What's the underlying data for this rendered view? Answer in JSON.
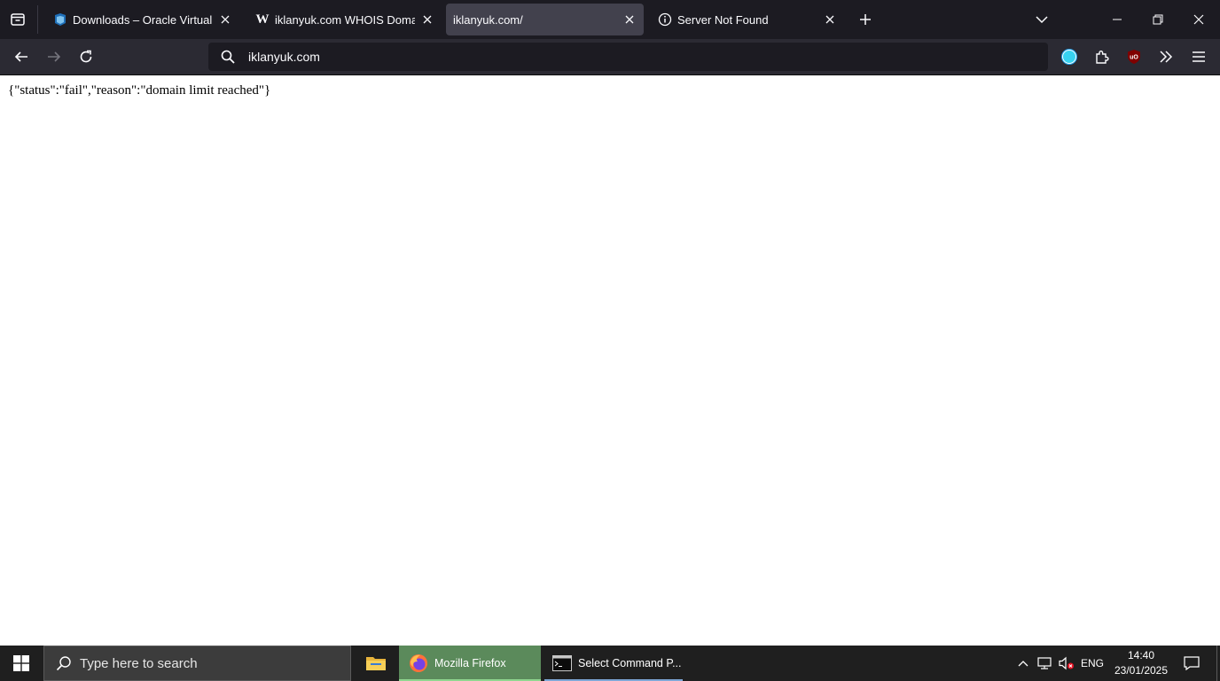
{
  "browser": {
    "tabs": [
      {
        "title": "Downloads – Oracle VirtualBox",
        "favicon": "virtualbox-icon",
        "active": false
      },
      {
        "title": "iklanyuk.com WHOIS Domain Name",
        "favicon": "wikipedia-w-icon",
        "active": false
      },
      {
        "title": "iklanyuk.com/",
        "favicon": "",
        "active": true
      },
      {
        "title": "Server Not Found",
        "favicon": "info-icon",
        "active": false
      }
    ],
    "url": "iklanyuk.com"
  },
  "page": {
    "body_text": "{\"status\":\"fail\",\"reason\":\"domain limit reached\"}"
  },
  "taskbar": {
    "search_placeholder": "Type here to search",
    "apps": [
      {
        "label": "",
        "icon": "file-explorer-icon"
      },
      {
        "label": "Mozilla Firefox",
        "icon": "firefox-icon"
      },
      {
        "label": "Select Command P...",
        "icon": "command-prompt-icon"
      }
    ],
    "language": "ENG",
    "time": "14:40",
    "date": "23/01/2025"
  },
  "colors": {
    "tabstrip_bg": "#1c1b22",
    "navbar_bg": "#2b2a33",
    "active_tab_bg": "#42414d",
    "firefox_taskbar_active": "#5b8a5b",
    "taskbar_bg": "#1f1f1f"
  }
}
